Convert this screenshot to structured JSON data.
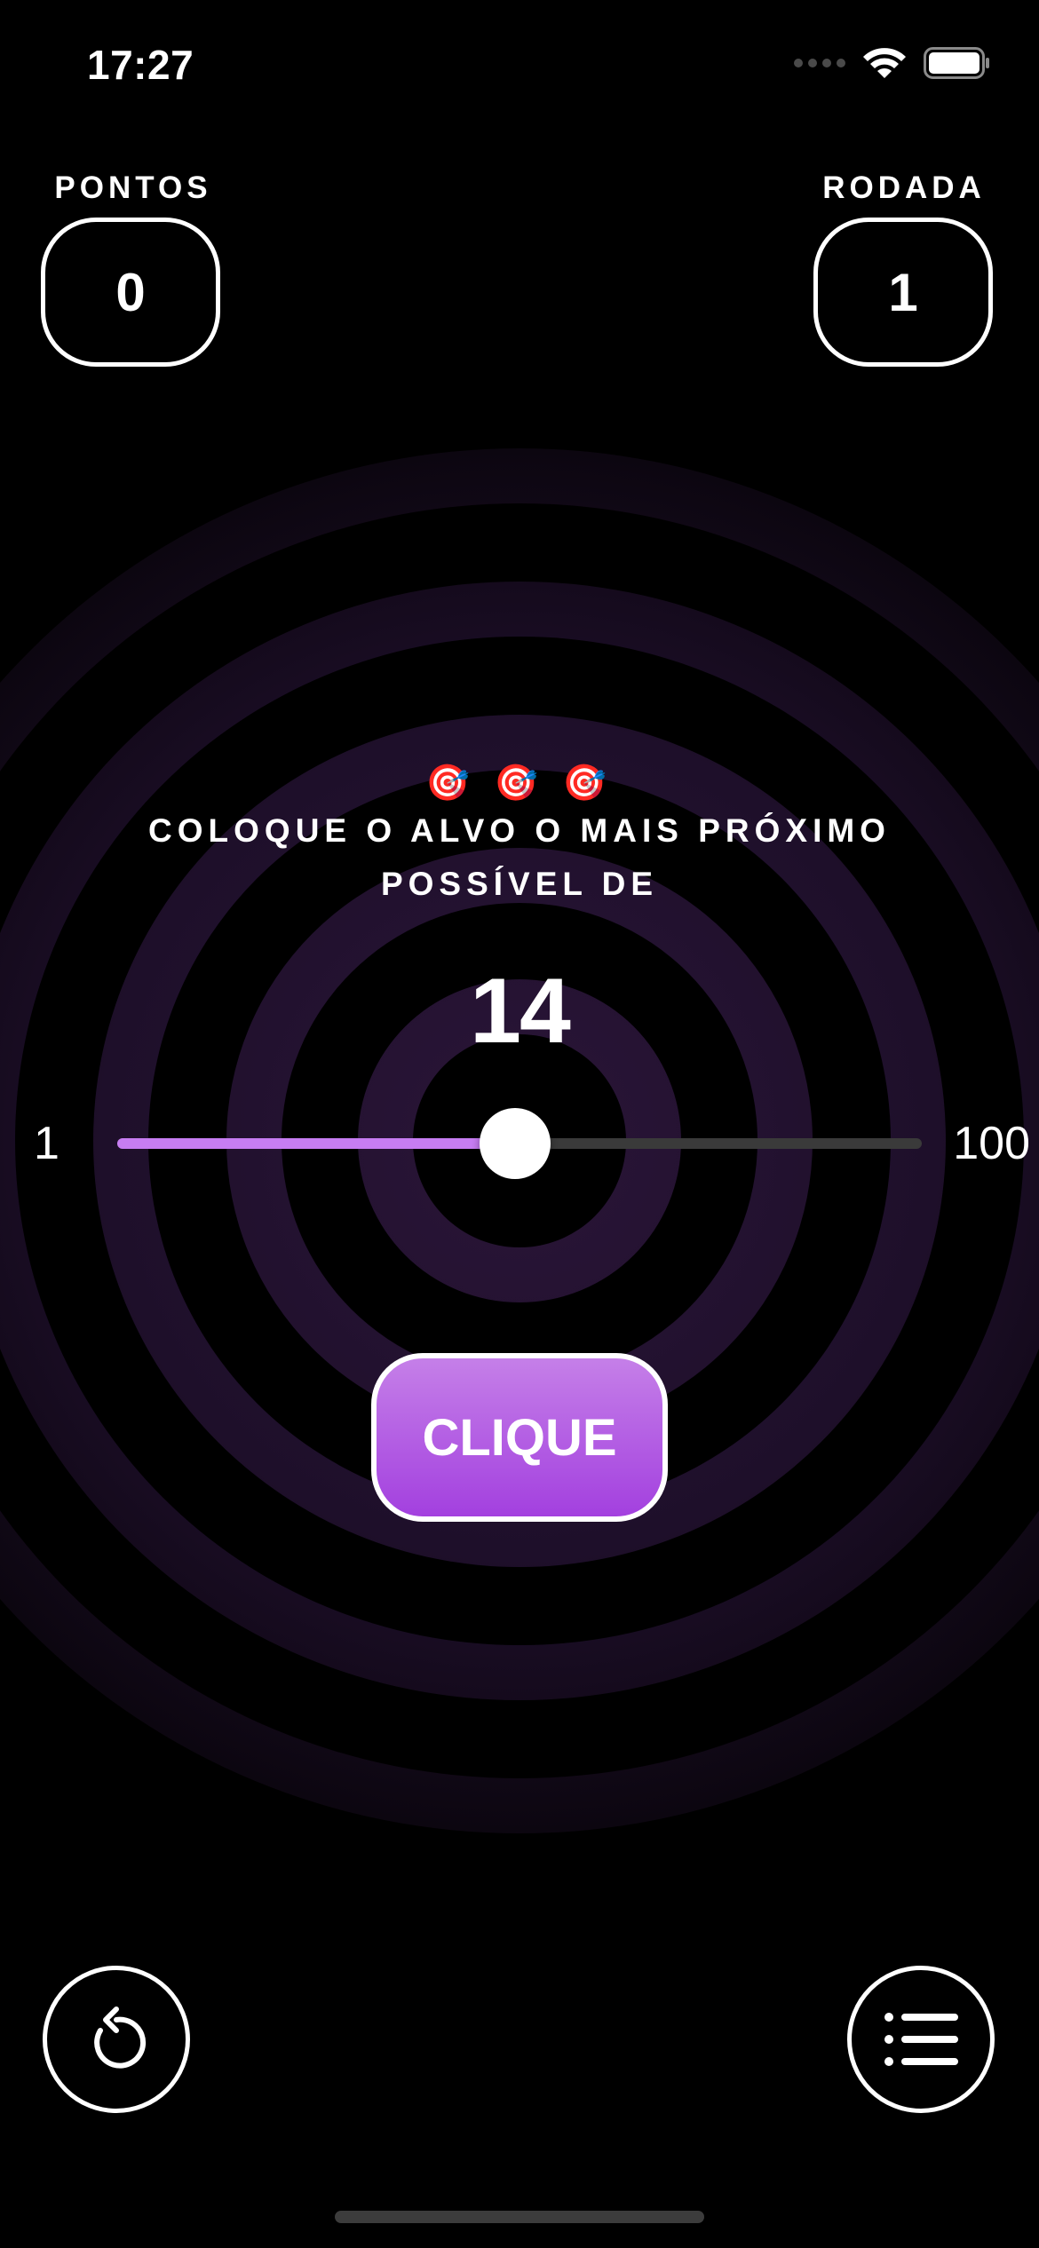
{
  "status_bar": {
    "time": "17:27"
  },
  "score": {
    "label": "PONTOS",
    "value": "0"
  },
  "round": {
    "label": "RODADA",
    "value": "1"
  },
  "instruction": {
    "emoji": "🎯 🎯 🎯",
    "text": "COLOQUE O ALVO O MAIS PRÓXIMO POSSÍVEL DE",
    "target": "14"
  },
  "slider": {
    "min_label": "1",
    "max_label": "100",
    "min": 1,
    "max": 100,
    "value": 50
  },
  "main_button": {
    "label": "CLIQUE"
  },
  "colors": {
    "background": "#000000",
    "accent": "#a340df",
    "slider_fill": "#c77df2",
    "ring": "#1c0f26"
  },
  "icons": {
    "restart": "restart-icon",
    "leaderboard": "list-icon"
  }
}
